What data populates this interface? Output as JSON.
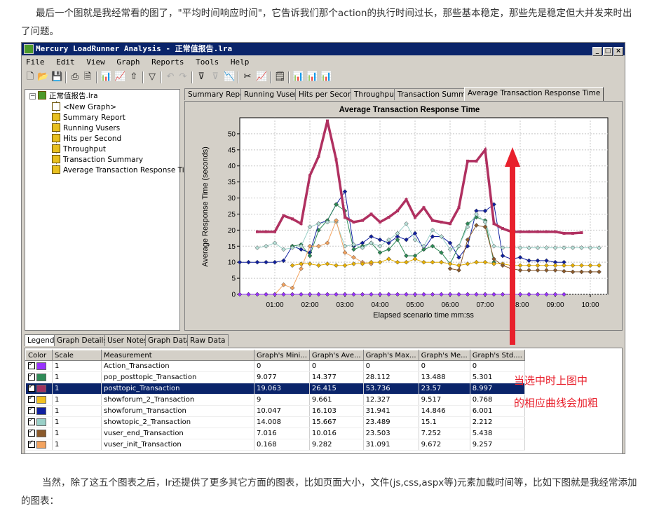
{
  "article": {
    "para_top": "最后一个图就是我经常看的图了，\"平均时间响应时间\"，它告诉我们那个action的执行时间过长，那些基本稳定，那些先是稳定但大并发来时出了问题。",
    "para_bottom": "当然，除了这五个图表之后，lr还提供了更多其它方面的图表，比如页面大小，文件(js,css,aspx等)元素加载时间等，比如下图就是我经常添加的图表："
  },
  "window": {
    "title": "Mercury LoadRunner Analysis - 正常值报告.lra",
    "buttons": [
      "_",
      "□",
      "×"
    ]
  },
  "menu": [
    "File",
    "Edit",
    "View",
    "Graph",
    "Reports",
    "Tools",
    "Help"
  ],
  "tree": {
    "root": "正常值报告.lra",
    "items": [
      "<New Graph>",
      "Summary Report",
      "Running Vusers",
      "Hits per Second",
      "Throughput",
      "Transaction Summary",
      "Average Transaction Response Time"
    ]
  },
  "tabs": [
    "Summary Report",
    "Running Vusers",
    "Hits per Second",
    "Throughput",
    "Transaction Summary",
    "Average Transaction Response Time"
  ],
  "active_tab": "Average Transaction Response Time",
  "bottom_tabs": [
    "Legend",
    "Graph Details",
    "User Notes",
    "Graph Data",
    "Raw Data"
  ],
  "legend": {
    "headers": [
      "Color",
      "Scale",
      "Measurement",
      "Graph's Mini...",
      "Graph's Ave...",
      "Graph's Max...",
      "Graph's Me...",
      "Graph's Std...."
    ],
    "rows": [
      {
        "color": "#9933ff",
        "scale": "1",
        "name": "Action_Transaction",
        "min": "0",
        "ave": "0",
        "max": "0",
        "med": "0",
        "std": "0"
      },
      {
        "color": "#2e8b57",
        "scale": "1",
        "name": "pop_posttopic_Transaction",
        "min": "9.077",
        "ave": "14.377",
        "max": "28.112",
        "med": "13.488",
        "std": "5.301"
      },
      {
        "color": "#a03060",
        "scale": "1",
        "name": "posttopic_Transaction",
        "min": "19.063",
        "ave": "26.415",
        "max": "53.736",
        "med": "23.57",
        "std": "8.997"
      },
      {
        "color": "#f0c020",
        "scale": "1",
        "name": "showforum_2_Transaction",
        "min": "9",
        "ave": "9.661",
        "max": "12.327",
        "med": "9.517",
        "std": "0.768"
      },
      {
        "color": "#1020a0",
        "scale": "1",
        "name": "showforum_Transaction",
        "min": "10.047",
        "ave": "16.103",
        "max": "31.941",
        "med": "14.846",
        "std": "6.001"
      },
      {
        "color": "#9ad0c8",
        "scale": "1",
        "name": "showtopic_2_Transaction",
        "min": "14.008",
        "ave": "15.667",
        "max": "23.489",
        "med": "15.1",
        "std": "2.212"
      },
      {
        "color": "#8b5a2b",
        "scale": "1",
        "name": "vuser_end_Transaction",
        "min": "7.016",
        "ave": "10.016",
        "max": "23.503",
        "med": "7.252",
        "std": "5.438"
      },
      {
        "color": "#f4a460",
        "scale": "1",
        "name": "vuser_init_Transaction",
        "min": "0.168",
        "ave": "9.282",
        "max": "31.091",
        "med": "9.672",
        "std": "9.257"
      }
    ],
    "selected_index": 2
  },
  "annotation": {
    "line1": "当选中时上图中",
    "line2": "的相应曲线会加粗",
    "color": "#e8202c"
  },
  "chart_data": {
    "type": "line",
    "title": "Average Transaction Response Time",
    "xlabel": "Elapsed scenario time mm:ss",
    "ylabel": "Average Response Time (seconds)",
    "ylim": [
      0,
      55
    ],
    "yticks": [
      0,
      5,
      10,
      15,
      20,
      25,
      30,
      35,
      40,
      45,
      50
    ],
    "xlim": [
      0,
      600
    ],
    "xticks": [
      "01:00",
      "02:00",
      "03:00",
      "04:00",
      "05:00",
      "06:00",
      "07:00",
      "08:00",
      "09:00",
      "10:00"
    ],
    "xtick_seconds": [
      60,
      120,
      180,
      240,
      300,
      360,
      420,
      480,
      540,
      600
    ],
    "grid": true,
    "series": [
      {
        "name": "posttopic_Transaction",
        "color": "#b03060",
        "bold": true,
        "x": [
          30,
          45,
          60,
          75,
          90,
          105,
          120,
          135,
          150,
          165,
          180,
          195,
          210,
          225,
          240,
          255,
          270,
          285,
          300,
          315,
          330,
          345,
          360,
          375,
          390,
          405,
          420,
          435,
          450,
          465,
          480,
          495,
          510,
          525,
          540,
          555,
          570,
          585
        ],
        "y": [
          19.5,
          19.5,
          19.5,
          24.5,
          23.5,
          22,
          37,
          43,
          54,
          42,
          24,
          22.5,
          23,
          25,
          22.5,
          24,
          26,
          29.5,
          24,
          27,
          23,
          22.5,
          22,
          27,
          41.5,
          41.5,
          45,
          22,
          20.5,
          19.5,
          19.5,
          19.5,
          19.5,
          19.5,
          19.5,
          19,
          19,
          19.2
        ]
      },
      {
        "name": "showforum_Transaction",
        "color": "#1020a0",
        "x": [
          0,
          15,
          30,
          45,
          60,
          75,
          90,
          105,
          120,
          135,
          150,
          165,
          180,
          195,
          210,
          225,
          240,
          255,
          270,
          285,
          300,
          315,
          330,
          345,
          360,
          375,
          390,
          405,
          420,
          435,
          450,
          465,
          480,
          495,
          510,
          525,
          540,
          555
        ],
        "y": [
          10,
          10,
          10,
          10,
          10,
          10.5,
          15,
          14,
          13,
          22,
          23,
          28,
          32,
          15,
          16,
          18,
          17,
          16,
          18,
          17,
          19,
          14,
          18,
          18,
          16,
          11.5,
          15,
          26,
          26,
          28,
          12,
          11,
          11.5,
          10.5,
          10.5,
          10.5,
          10,
          10
        ]
      },
      {
        "name": "pop_posttopic_Transaction",
        "color": "#2e8b57",
        "x": [
          90,
          105,
          120,
          135,
          150,
          165,
          180,
          195,
          210,
          225,
          240,
          255,
          270,
          285,
          300,
          315,
          330,
          345,
          360,
          375,
          390,
          405,
          420,
          435
        ],
        "y": [
          15,
          15.5,
          12,
          20,
          23,
          28,
          26,
          14,
          15,
          16,
          13,
          14,
          17,
          12,
          12,
          14,
          15,
          13,
          9.5,
          15,
          22,
          24,
          23,
          10
        ]
      },
      {
        "name": "showtopic_2_Transaction",
        "color": "#9ad0c8",
        "x": [
          30,
          45,
          60,
          75,
          90,
          105,
          120,
          135,
          150,
          165,
          180,
          195,
          210,
          225,
          240,
          255,
          270,
          285,
          300,
          315,
          330,
          345,
          360,
          375,
          390,
          405,
          420,
          435,
          450,
          465,
          480,
          495,
          510,
          525,
          540,
          555,
          570,
          585,
          600,
          615
        ],
        "y": [
          14.5,
          15,
          16,
          14,
          14.5,
          15,
          21,
          22,
          22.5,
          22.5,
          15,
          15.5,
          14.5,
          16,
          15,
          17,
          19,
          22,
          17,
          15,
          20,
          18,
          14,
          15,
          21,
          25,
          22.5,
          15,
          14.5,
          14.5,
          14.5,
          14.5,
          14.5,
          14.5,
          14.5,
          14.5,
          14.5,
          14.5,
          14.5,
          14.5
        ]
      },
      {
        "name": "vuser_init_Transaction",
        "color": "#f4a460",
        "x": [
          30,
          45,
          60,
          75,
          90,
          105,
          120,
          135,
          150,
          165,
          180,
          195,
          210,
          225
        ],
        "y": [
          0,
          0,
          0,
          3,
          2,
          8,
          15,
          15,
          16,
          23,
          13,
          11.5,
          10,
          9.5
        ]
      },
      {
        "name": "showforum_2_Transaction",
        "color": "#e8b000",
        "x": [
          90,
          105,
          120,
          135,
          150,
          165,
          180,
          195,
          210,
          225,
          240,
          255,
          270,
          285,
          300,
          315,
          330,
          345,
          360,
          375,
          390,
          405,
          420,
          435,
          450,
          465,
          480,
          495,
          510,
          525,
          540,
          555,
          570,
          585,
          600,
          615
        ],
        "y": [
          9,
          9.5,
          9.5,
          9,
          9.5,
          9,
          9,
          9.5,
          9.5,
          10,
          10,
          11,
          10,
          10,
          11,
          10,
          10,
          10,
          9.5,
          9,
          9.5,
          10,
          10,
          9.5,
          9.5,
          9,
          9,
          9,
          9,
          9,
          9,
          9,
          9,
          9,
          9,
          9
        ]
      },
      {
        "name": "vuser_end_Transaction",
        "color": "#8b5a2b",
        "x": [
          360,
          375,
          390,
          405,
          420,
          435,
          450,
          465,
          480,
          495,
          510,
          525,
          540,
          555,
          570,
          585,
          600,
          615
        ],
        "y": [
          8,
          7.5,
          17,
          21.5,
          21,
          11,
          9,
          8,
          7.5,
          7.5,
          7.5,
          7.5,
          7.5,
          7.2,
          7,
          7,
          7,
          7
        ]
      },
      {
        "name": "Action_Transaction",
        "color": "#9933ff",
        "x": [
          0,
          15,
          30,
          45,
          60,
          75,
          90,
          105,
          120,
          135,
          150,
          165,
          180,
          195,
          210,
          225,
          240,
          255,
          270,
          285,
          300,
          315,
          330,
          345,
          360,
          375,
          390,
          405,
          420,
          435,
          450,
          465,
          480,
          495,
          510,
          525,
          540,
          555
        ],
        "y": [
          0,
          0,
          0,
          0,
          0,
          0,
          0,
          0,
          0,
          0,
          0,
          0,
          0,
          0,
          0,
          0,
          0,
          0,
          0,
          0,
          0,
          0,
          0,
          0,
          0,
          0,
          0,
          0,
          0,
          0,
          0,
          0,
          0,
          0,
          0,
          0,
          0,
          0
        ]
      }
    ]
  }
}
